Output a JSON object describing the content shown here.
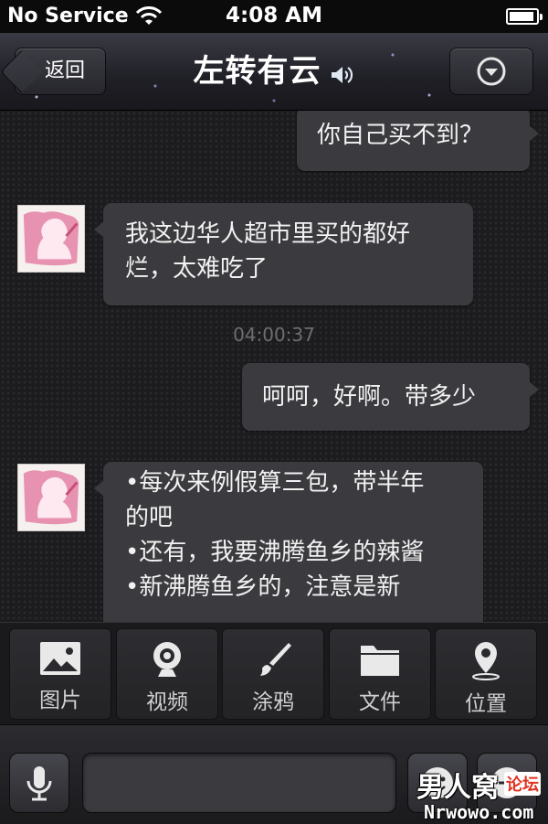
{
  "status_bar": {
    "carrier": "No Service",
    "time": "4:08 AM"
  },
  "nav": {
    "back_label": "返回",
    "title": "左转有云",
    "icons": {
      "speaker": "speaker-icon",
      "menu": "chevron-down-circle-icon"
    }
  },
  "chat": {
    "messages": [
      {
        "direction": "outgoing",
        "text": "你自己买不到？"
      },
      {
        "direction": "incoming",
        "lines": [
          "我这边华人超市里买的都好",
          "烂，太难吃了"
        ]
      },
      {
        "direction": "outgoing",
        "text": "呵呵，好啊。带多少"
      },
      {
        "direction": "incoming",
        "lines": [
          "•每次来例假算三包，带半年",
          "的吧",
          "•还有，我要沸腾鱼乡的辣酱",
          "•新沸腾鱼乡的，注意是新"
        ]
      }
    ],
    "timestamp": "04:00:37"
  },
  "actions": [
    {
      "label": "图片",
      "icon": "image-icon"
    },
    {
      "label": "视频",
      "icon": "webcam-icon"
    },
    {
      "label": "涂鸦",
      "icon": "brush-icon"
    },
    {
      "label": "文件",
      "icon": "folder-icon"
    },
    {
      "label": "位置",
      "icon": "location-pin-icon"
    }
  ],
  "input_bar": {
    "value": "",
    "icons": {
      "mic": "microphone-icon",
      "emoji": "emoji-icon",
      "plus": "plus-icon"
    }
  },
  "watermark": {
    "line1": "男人窝",
    "line1_badge": "论坛",
    "line2": "Nrwowo.com"
  }
}
